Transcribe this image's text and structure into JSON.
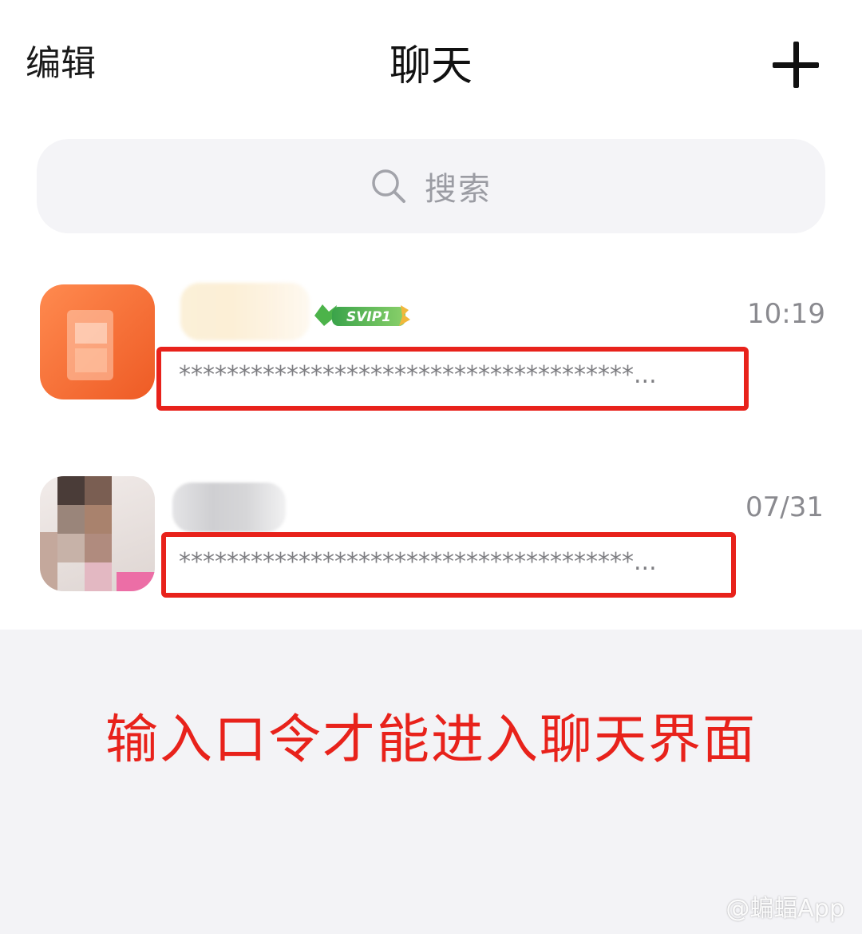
{
  "header": {
    "edit_label": "编辑",
    "title": "聊天",
    "add_icon": "plus-icon"
  },
  "search": {
    "icon": "search-icon",
    "placeholder": "搜索"
  },
  "chats": [
    {
      "time": "10:19",
      "badge": "SVIP1",
      "preview": "**************************************...",
      "avatar_color": "#f26a2e"
    },
    {
      "time": "07/31",
      "preview": "**************************************..."
    }
  ],
  "notice": "输入口令才能进入聊天界面",
  "watermark": "@蝙蝠App",
  "colors": {
    "accent_red": "#e8221b",
    "search_bg": "#f4f4f7",
    "bottom_bg": "#f3f3f6"
  }
}
